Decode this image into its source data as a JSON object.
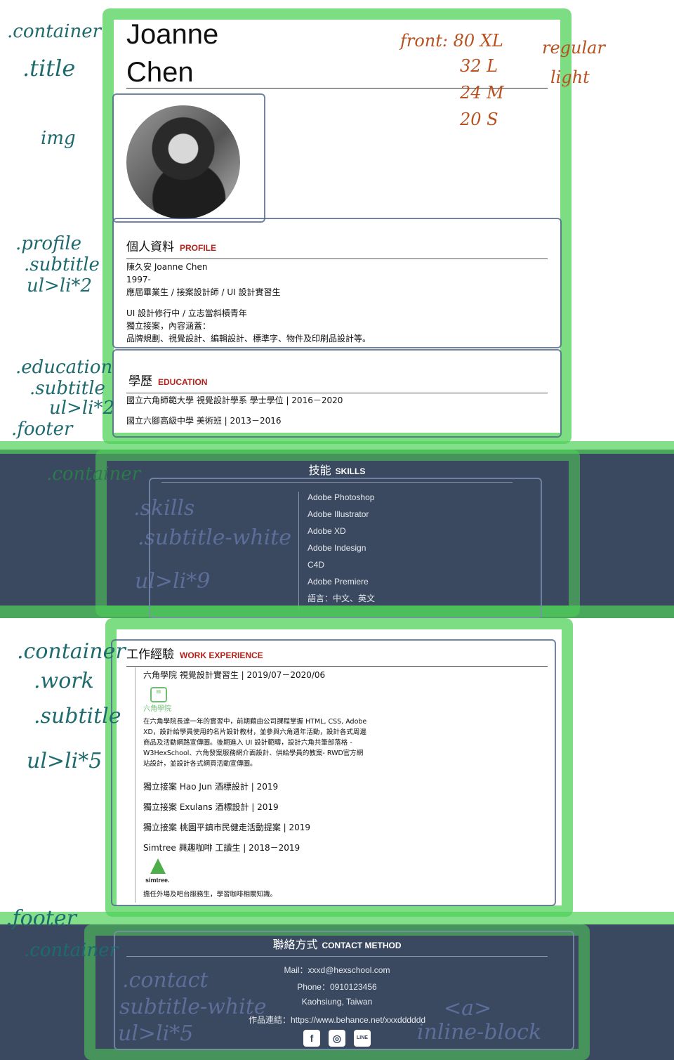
{
  "annotations": {
    "container": ".container",
    "title": ".title",
    "img": "img",
    "font_line1": "front: 80  XL",
    "font_line2": "32  L",
    "font_line3": "24  M",
    "font_line4": "20  S",
    "regular": "regular",
    "light": "light",
    "profile": ".profile",
    "subtitle": ".subtitle",
    "ul_li_2": "ul>li*2",
    "education": ".education",
    "ul_li_2b": "ul>li*2",
    "footer": ".footer",
    "skills_container": ".container",
    "skills": ".skills",
    "subtitle_white": ".subtitle-white",
    "ul_li_9": "ul>li*9",
    "work_container": ".container",
    "work": ".work",
    "work_subtitle": ".subtitle",
    "ul_li_5": "ul>li*5",
    "footer2": ".footer",
    "footer_container": ".container",
    "contact": ".contact",
    "contact_subtitle": "subtitle-white",
    "ul_li_5b": "ul>li*5",
    "a_tag": "<a>",
    "inline_block": "inline-block"
  },
  "header": {
    "name_line1": "Joanne",
    "name_line2": "Chen"
  },
  "profile": {
    "title_zh": "個人資料",
    "title_en": "PROFILE",
    "line1": "陳久安 Joanne Chen",
    "line2": "1997-",
    "line3": "應屆畢業生 / 接案設計師 / UI 設計實習生",
    "line4": "UI 設計修行中 / 立志當斜槓青年",
    "line5": "獨立接案，內容涵蓋：",
    "line6": "品牌規劃、視覺設計、編輯設計、標準字、物件及印刷品設計等。"
  },
  "education": {
    "title_zh": "學歷",
    "title_en": "EDUCATION",
    "item1": "國立六角師範大學 視覺設計學系 學士學位 | 2016－2020",
    "item2": "國立六腳高級中學 美術班 | 2013－2016"
  },
  "skills": {
    "title_zh": "技能",
    "title_en": "SKILLS",
    "items": [
      "Adobe Photoshop",
      "Adobe Illustrator",
      "Adobe XD",
      "Adobe Indesign",
      "C4D",
      "Adobe Premiere",
      "語言：中文、英文"
    ]
  },
  "work": {
    "title_zh": "工作經驗",
    "title_en": "WORK EXPERIENCE",
    "job1": "六角學院 視覺設計實習生 | 2019/07－2020/06",
    "job1_logo": "六角學院",
    "job1_desc": "在六角學院長達一年的實習中，前期藉由公司課程掌握 HTML, CSS, Adobe XD，設計給學員使用的名片設計教材，並參與六角週年活動，設計各式周邊商品及活動網路宣傳圖。後期進入 UI 設計範疇，設計六角共筆部落格 - W3HexSchool、六角發案服務網介面設計、供給學員的教案- RWD官方網站設計，並設計各式網頁活動宣傳圖。",
    "job2": "獨立接案 Hao Jun 酒標設計 | 2019",
    "job3": "獨立接案 Exulans 酒標設計 | 2019",
    "job4": "獨立接案 桃園平鎮市民健走活動提案 | 2019",
    "job5": "Simtree 興趣咖啡 工讀生 | 2018－2019",
    "job5_logo": "simtree.",
    "job5_desc": "擔任外場及吧台服務生，學習咖啡相關知識。"
  },
  "contact": {
    "title_zh": "聯絡方式",
    "title_en": "CONTACT METHOD",
    "mail": "Mail：xxxd@hexschool.com",
    "phone": "Phone：0910123456",
    "address": "Kaohsiung, Taiwan",
    "portfolio": "作品連結：https://www.behance.net/xxxdddddd",
    "social": [
      "facebook-icon",
      "instagram-icon",
      "line-icon"
    ],
    "line_label": "LINE"
  },
  "colors": {
    "band": "#3a4960",
    "accent": "#b3211b",
    "highlighter": "#50d25a"
  }
}
